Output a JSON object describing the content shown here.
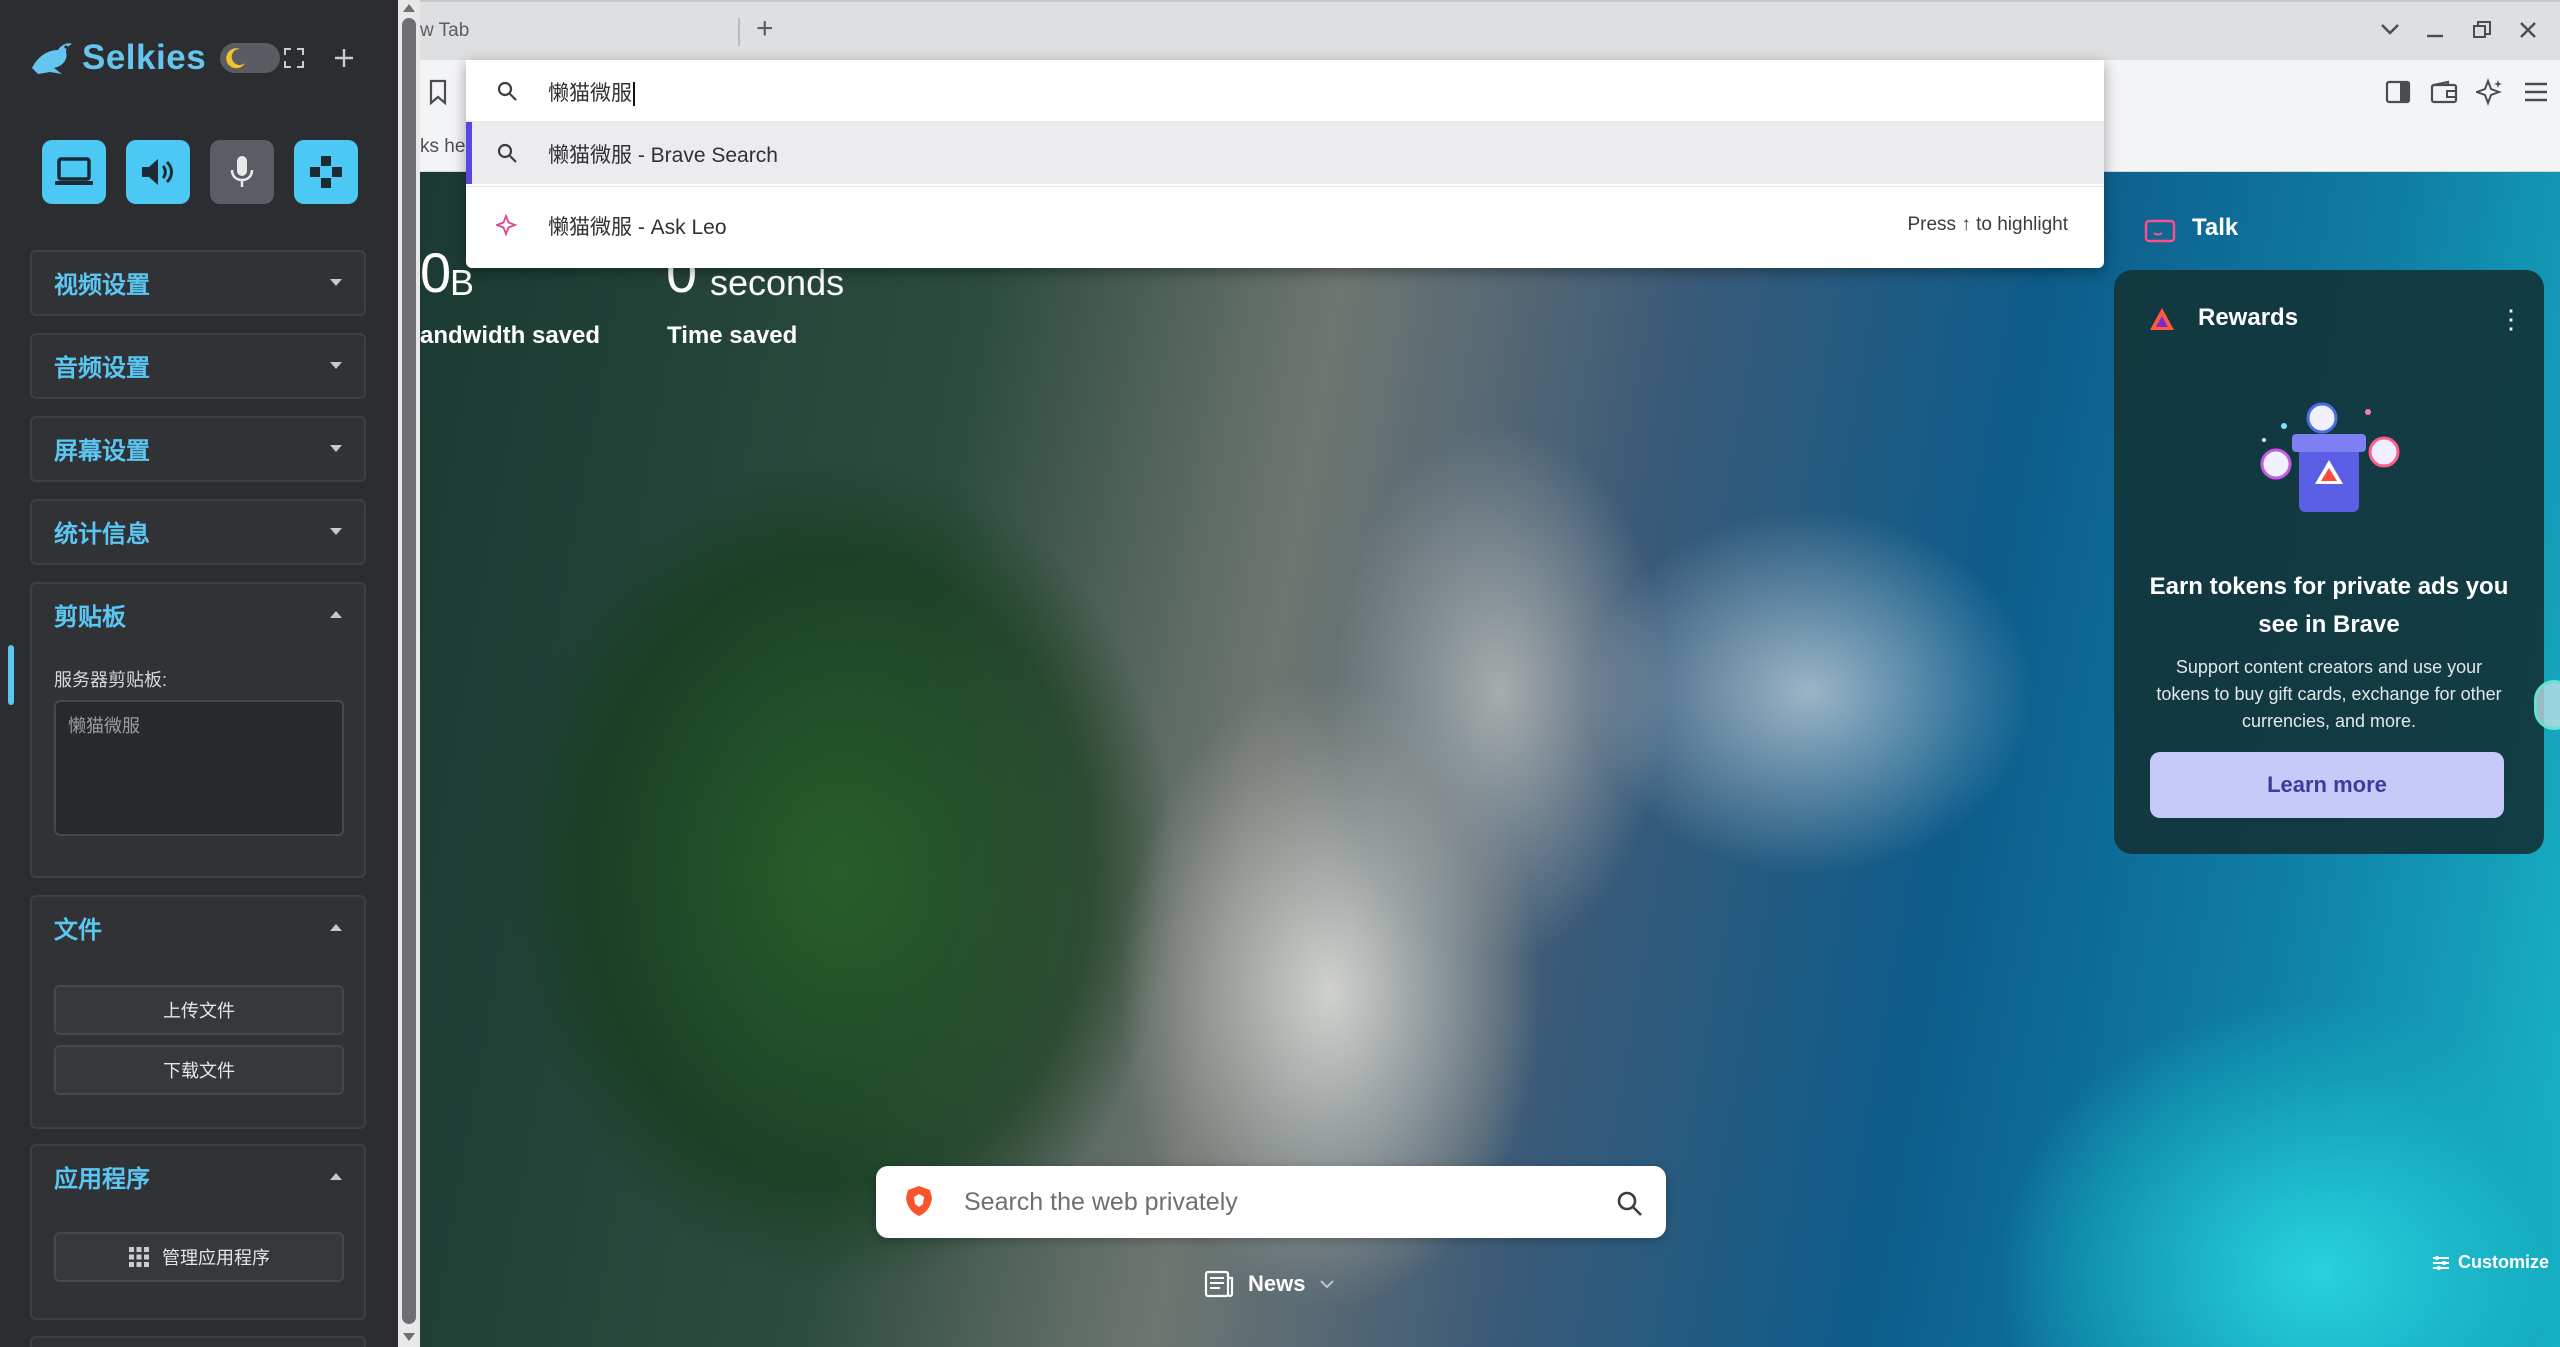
{
  "sidebar": {
    "app_title": "Selkies",
    "colors": {
      "accent": "#5cc6f2",
      "tool_on": "#4cc8f4",
      "tool_off": "#5a5d63",
      "panel_bg": "#303236"
    },
    "tools": [
      {
        "name": "display-icon",
        "state": "on"
      },
      {
        "name": "speaker-icon",
        "state": "on"
      },
      {
        "name": "microphone-icon",
        "state": "off"
      },
      {
        "name": "gamepad-icon",
        "state": "on"
      }
    ],
    "sections": {
      "video": {
        "title": "视频设置"
      },
      "audio": {
        "title": "音频设置"
      },
      "screen": {
        "title": "屏幕设置"
      },
      "stats": {
        "title": "统计信息"
      },
      "clipboard": {
        "title": "剪贴板",
        "field_label": "服务器剪贴板:",
        "value": "懒猫微服"
      },
      "files": {
        "title": "文件",
        "upload_label": "上传文件",
        "download_label": "下载文件"
      },
      "apps": {
        "title": "应用程序",
        "manage_label": "管理应用程序"
      }
    }
  },
  "browser": {
    "tab_title": "w Tab",
    "bookmarks_bar_text": "ks he",
    "omnibox": {
      "input_value": "懒猫微服",
      "suggestions": [
        {
          "text": "懒猫微服 - Brave Search",
          "icon": "search-icon",
          "selected": true
        },
        {
          "text": "懒猫微服 - Ask Leo",
          "icon": "leo-icon",
          "hint": "Press ↑ to highlight"
        }
      ]
    },
    "stats": [
      {
        "value": "0",
        "unit": "B",
        "label": "andwidth saved"
      },
      {
        "value": "0",
        "unit": "seconds",
        "label": "Time saved"
      }
    ],
    "talk": {
      "label": "Talk"
    },
    "rewards": {
      "label": "Rewards",
      "title": "Earn tokens for private ads you see in Brave",
      "body": "Support content creators and use your tokens to buy gift cards, exchange for other currencies, and more.",
      "button": "Learn more"
    },
    "search": {
      "placeholder": "Search the web privately"
    },
    "news_label": "News",
    "customize_label": "Customize"
  }
}
